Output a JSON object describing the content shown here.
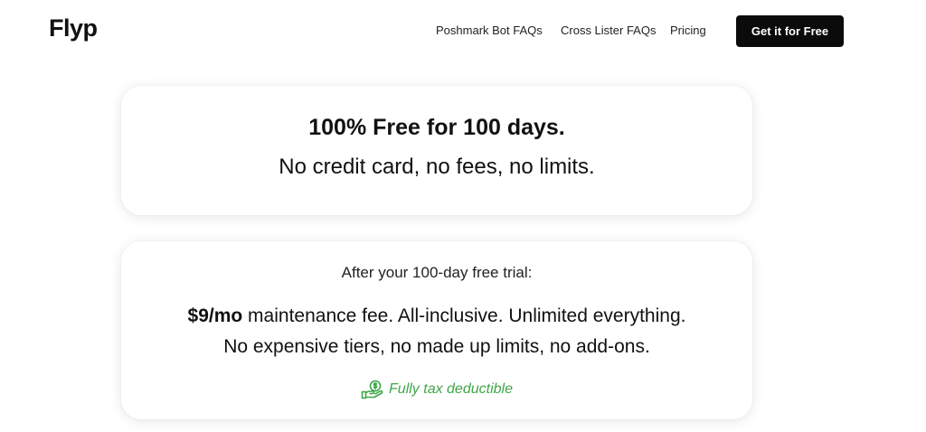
{
  "header": {
    "logo": "Flyp",
    "nav": [
      {
        "label": "Poshmark Bot FAQs"
      },
      {
        "label": "Cross Lister FAQs"
      },
      {
        "label": "Pricing"
      }
    ],
    "cta_label": "Get it for Free"
  },
  "promo_card": {
    "headline": "100% Free for 100 days.",
    "subline": "No credit card, no fees, no limits."
  },
  "pricing_card": {
    "trial_label": "After your 100-day free trial:",
    "price": "$9/mo",
    "price_rest": " maintenance fee. All-inclusive. Unlimited everything.",
    "tiers_line": "No expensive tiers, no made up limits, no add-ons.",
    "tax_label": "Fully tax deductible",
    "tax_icon": "hand-money-icon"
  },
  "colors": {
    "accent_green": "#3fa649",
    "cta_background": "#0b0b0b"
  }
}
